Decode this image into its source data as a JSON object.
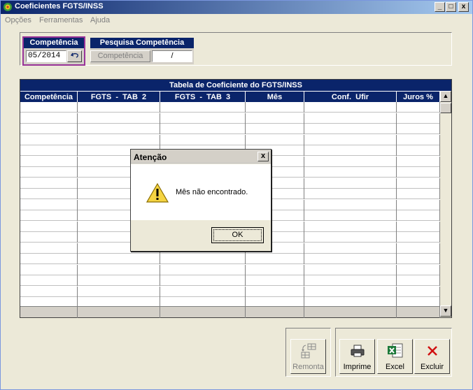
{
  "window": {
    "title": "Coeficientes FGTS/INSS",
    "controls": [
      "_",
      "□",
      "x"
    ]
  },
  "menu": [
    "Opções",
    "Ferramentas",
    "Ajuda"
  ],
  "competencia": {
    "header": "Competência",
    "value": "05/2014"
  },
  "pesquisa": {
    "header": "Pesquisa Competência",
    "button_label": "Competência",
    "field_value": "/"
  },
  "grid": {
    "title": "Tabela de Coeficiente do FGTS/INSS",
    "columns": [
      "Competência",
      "FGTS  -  TAB  2",
      "FGTS  -  TAB  3",
      "Mês",
      "Conf.  Ufir",
      "Juros %"
    ],
    "scroll_up": "▲",
    "scroll_down": "▼"
  },
  "dialog": {
    "title": "Atenção",
    "close": "x",
    "message": "Mês não encontrado.",
    "ok_label": "OK"
  },
  "toolbar": {
    "remonta": "Remonta",
    "imprime": "Imprime",
    "excel": "Excel",
    "excluir": "Excluir"
  }
}
